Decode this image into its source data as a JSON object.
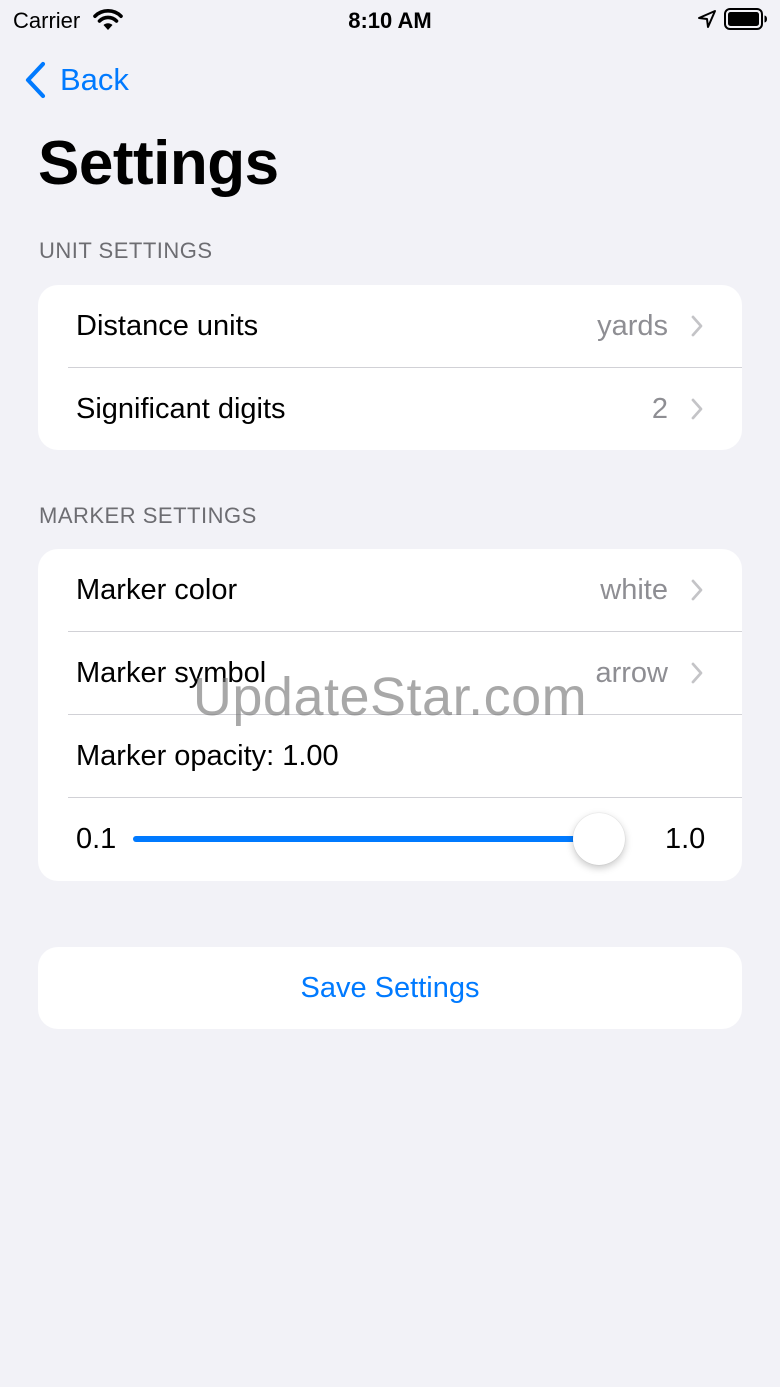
{
  "status_bar": {
    "carrier": "Carrier",
    "time": "8:10 AM"
  },
  "nav": {
    "back_label": "Back",
    "title": "Settings"
  },
  "sections": {
    "unit": {
      "header": "UNIT SETTINGS",
      "rows": [
        {
          "label": "Distance units",
          "value": "yards"
        },
        {
          "label": "Significant digits",
          "value": "2"
        }
      ]
    },
    "marker": {
      "header": "MARKER SETTINGS",
      "rows": [
        {
          "label": "Marker color",
          "value": "white"
        },
        {
          "label": "Marker symbol",
          "value": "arrow"
        }
      ],
      "opacity_label": "Marker opacity:",
      "opacity_value": "1.00",
      "slider": {
        "min_label": "0.1",
        "max_label": "1.0",
        "min": 0.1,
        "max": 1.0,
        "value": 1.0
      }
    }
  },
  "save_button": {
    "label": "Save Settings"
  },
  "watermark": "UpdateStar.com",
  "colors": {
    "accent": "#007AFF",
    "background": "#F2F2F7",
    "card": "#FFFFFF",
    "secondary_text": "#8E8E93"
  },
  "icons": {
    "wifi": "wifi-icon",
    "location": "location-arrow-icon",
    "battery": "battery-icon",
    "back": "chevron-left-icon",
    "row_disclosure": "chevron-right-icon"
  }
}
